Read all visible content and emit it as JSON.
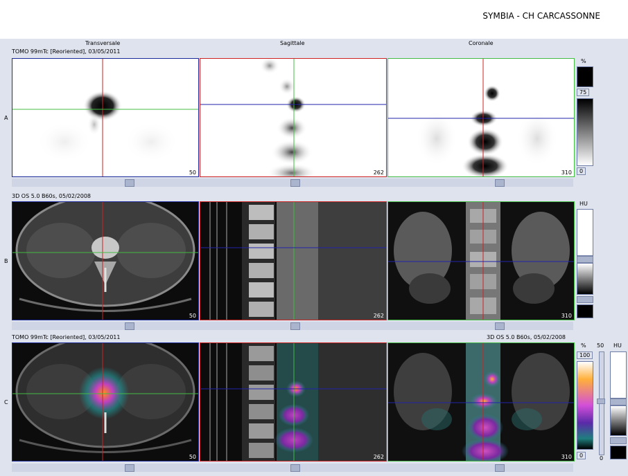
{
  "header": {
    "site": "SYMBIA - CH CARCASSONNE"
  },
  "columns": [
    "Transversale",
    "Sagittale",
    "Coronale"
  ],
  "rows": [
    {
      "letter": "A",
      "info_left": "TOMO 99mTc [Reoriented], 03/05/2011",
      "info_right": "",
      "slices": [
        "50",
        "262",
        "310"
      ],
      "scale_unit": "%",
      "scale_values": [
        "75",
        "0"
      ]
    },
    {
      "letter": "B",
      "info_left": "3D  OS  5.0  B60s, 05/02/2008",
      "info_right": "",
      "slices": [
        "50",
        "262",
        "310"
      ],
      "scale_unit": "HU",
      "scale_values": []
    },
    {
      "letter": "C",
      "info_left": "TOMO 99mTc [Reoriented], 03/05/2011",
      "info_right": "3D  OS  5.0  B60s, 05/02/2008",
      "slices": [
        "50",
        "262",
        "310"
      ],
      "scale_unit": "%",
      "scale_values": [
        "100",
        "0"
      ]
    }
  ],
  "fusion": {
    "blend_top": "50",
    "blend_bottom": "0",
    "second_unit": "HU"
  },
  "colors": {
    "transverse": "#cc2222",
    "sagittal": "#2222aa",
    "coronal": "#44bb44",
    "frame_bg": "#dfe3ee"
  }
}
